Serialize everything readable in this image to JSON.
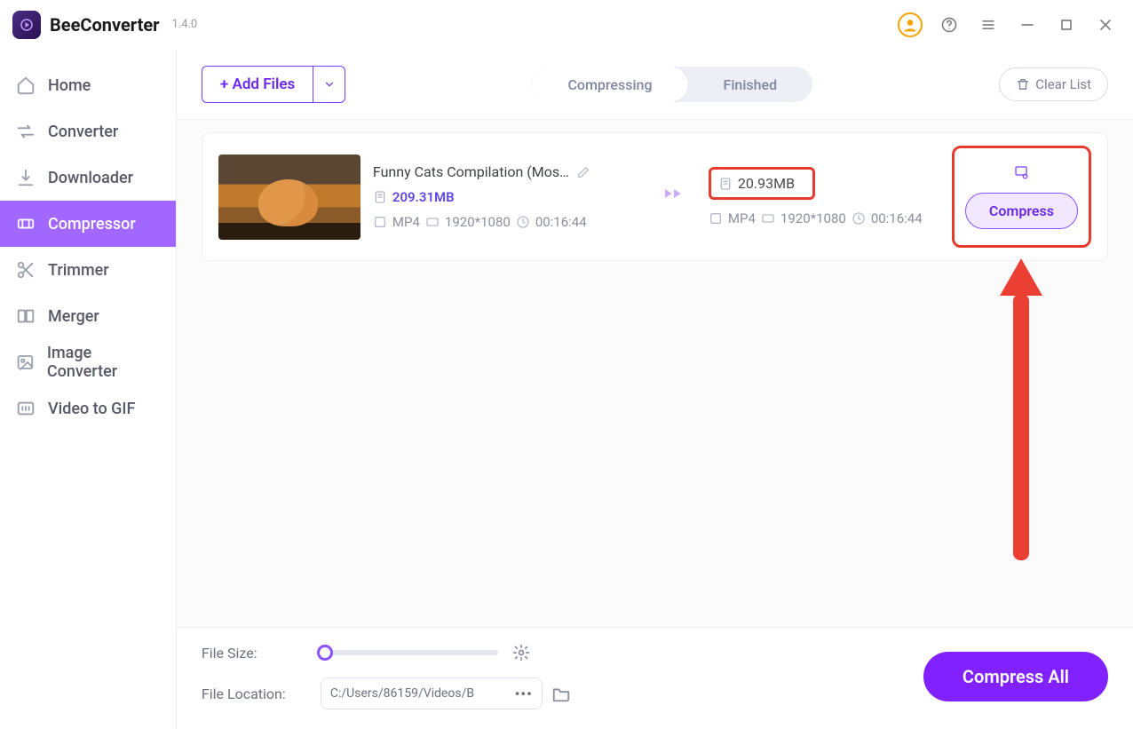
{
  "app": {
    "name": "BeeConverter",
    "version": "1.4.0"
  },
  "sidebar": {
    "items": [
      {
        "label": "Home"
      },
      {
        "label": "Converter"
      },
      {
        "label": "Downloader"
      },
      {
        "label": "Compressor"
      },
      {
        "label": "Trimmer"
      },
      {
        "label": "Merger"
      },
      {
        "label": "Image Converter"
      },
      {
        "label": "Video to GIF"
      }
    ]
  },
  "toolbar": {
    "add_files": "+ Add Files",
    "tab_compressing": "Compressing",
    "tab_finished": "Finished",
    "clear_list": "Clear List"
  },
  "file": {
    "title": "Funny Cats Compilation (Mos…",
    "source": {
      "size": "209.31MB",
      "format": "MP4",
      "resolution": "1920*1080",
      "duration": "00:16:44"
    },
    "target": {
      "size": "20.93MB",
      "format": "MP4",
      "resolution": "1920*1080",
      "duration": "00:16:44"
    },
    "compress_label": "Compress"
  },
  "footer": {
    "size_label": "File Size:",
    "location_label": "File Location:",
    "path_value": "C:/Users/86159/Videos/B",
    "compress_all": "Compress All"
  }
}
